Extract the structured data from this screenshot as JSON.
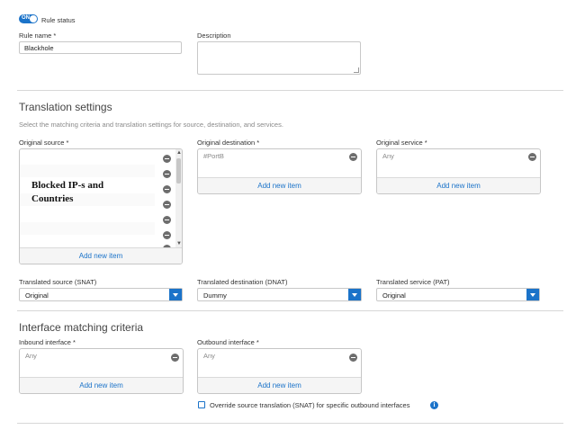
{
  "rule_status": {
    "toggle_text": "ON",
    "label": "Rule status"
  },
  "rule_name": {
    "label": "Rule name *",
    "value": "Blackhole"
  },
  "description": {
    "label": "Description",
    "value": ""
  },
  "translation_settings": {
    "title": "Translation settings",
    "hint": "Select the matching criteria and translation settings for source, destination, and services."
  },
  "original_source": {
    "label": "Original source *",
    "overlay_text_line1": "Blocked IP-s and",
    "overlay_text_line2": "Countries",
    "add_label": "Add new item"
  },
  "original_destination": {
    "label": "Original destination *",
    "value": "#PortB",
    "add_label": "Add new item"
  },
  "original_service": {
    "label": "Original service *",
    "value": "Any",
    "add_label": "Add new item"
  },
  "translated_source": {
    "label": "Translated source (SNAT)",
    "value": "Original"
  },
  "translated_destination": {
    "label": "Translated destination (DNAT)",
    "value": "Dummy"
  },
  "translated_service": {
    "label": "Translated service (PAT)",
    "value": "Original"
  },
  "interface_matching": {
    "title": "Interface matching criteria"
  },
  "inbound_interface": {
    "label": "Inbound interface *",
    "value": "Any",
    "add_label": "Add new item"
  },
  "outbound_interface": {
    "label": "Outbound interface *",
    "value": "Any",
    "add_label": "Add new item"
  },
  "override": {
    "label": "Override source translation (SNAT) for specific outbound interfaces",
    "checked": false
  },
  "colors": {
    "accent": "#1b73c9",
    "remove": "#6d6d6d"
  }
}
